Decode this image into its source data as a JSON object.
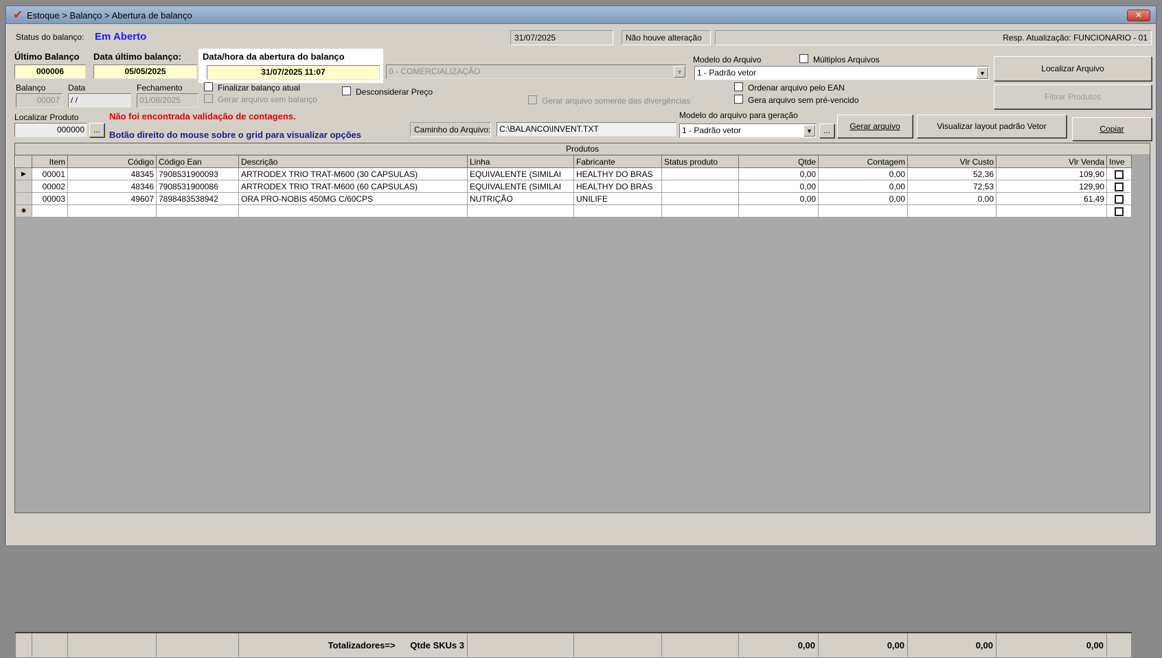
{
  "window": {
    "title": "Estoque > Balanço > Abertura de balanço",
    "logo": "✔",
    "close": "✕"
  },
  "status": {
    "label": "Status do balanço:",
    "value": "Em Aberto",
    "date": "31/07/2025",
    "alteration": "Não houve alteração",
    "resp": "Resp. Atualização: FUNCIONARIO - 01"
  },
  "header": {
    "ultimo_balanco_label": "Último Balanço",
    "ultimo_balanco_value": "000006",
    "data_ultimo_label": "Data último balanço:",
    "data_ultimo_value": "05/05/2025",
    "abertura_label": "Data/hora da abertura do balanço",
    "abertura_value": "31/07/2025 11:07",
    "comercializacao": "0 - COMERCIALIZAÇÃO",
    "modelo_arquivo_label": "Modelo do Arquivo",
    "modelo_arquivo_value": "1 - Padrão vetor",
    "multiplos_label": "Múltiplos Arquivos",
    "localizar_arquivo": "Localizar Arquivo",
    "filtrar_produtos": "Filtrar Produtos"
  },
  "form": {
    "balanco_label": "Balanço",
    "balanco_value": "00007",
    "data_label": "Data",
    "data_value": " / /",
    "fechamento_label": "Fechamento",
    "fechamento_value": "01/08/2025",
    "finalizar_label": "Finalizar balanço atual",
    "gerar_sem_balanco_label": "Gerar arquivo sem balanço",
    "desconsiderar_label": "Desconsiderar Preço",
    "gerar_divergencias_label": "Gerar arquivo somente das divergências",
    "ordenar_ean_label": "Ordenar arquivo pelo EAN",
    "gera_pre_vencido_label": "Gera arquivo sem pré-vencido",
    "localizar_produto_label": "Localizar Produto",
    "localizar_produto_value": "000000",
    "ellipsis": "...",
    "validacao_msg": "Não foi encontrada validação de contagens.",
    "botao_direito_msg": "Botão direito do mouse sobre o grid para visualizar opções",
    "caminho_label": "Caminho do Arquivo:",
    "caminho_value": "C:\\BALANCO\\INVENT.TXT",
    "modelo_geracao_label": "Modelo do arquivo para geração",
    "modelo_geracao_value": "1 - Padrão vetor",
    "gerar_arquivo": "Gerar arquivo",
    "visualizar_layout": "Visualizar layout padrão Vetor",
    "copiar": "Copiar"
  },
  "grid": {
    "caption": "Produtos",
    "columns": [
      "Item",
      "Código",
      "Código Ean",
      "Descrição",
      "Linha",
      "Fabricante",
      "Status produto",
      "Qtde",
      "Contagem",
      "Vlr Custo",
      "Vlr Venda",
      "Inve"
    ],
    "rows": [
      {
        "ind": "▶",
        "item": "00001",
        "codigo": "48345",
        "ean": "7908531900093",
        "descricao": "ARTRODEX TRIO TRAT-M600 (30 CAPSULAS)",
        "linha": "EQUIVALENTE (SIMILAI",
        "fabricante": "HEALTHY DO BRAS",
        "status": "",
        "qtde": "0,00",
        "contagem": "0,00",
        "custo": "52,36",
        "venda": "109,90"
      },
      {
        "ind": "",
        "item": "00002",
        "codigo": "48346",
        "ean": "7908531900086",
        "descricao": "ARTRODEX TRIO TRAT-M600 (60 CAPSULAS)",
        "linha": "EQUIVALENTE (SIMILAI",
        "fabricante": "HEALTHY DO BRAS",
        "status": "",
        "qtde": "0,00",
        "contagem": "0,00",
        "custo": "72,53",
        "venda": "129,90"
      },
      {
        "ind": "",
        "item": "00003",
        "codigo": "49607",
        "ean": "7898483538942",
        "descricao": "ORA PRO-NOBIS 450MG C/60CPS",
        "linha": "NUTRIÇÃO",
        "fabricante": "UNILIFE",
        "status": "",
        "qtde": "0,00",
        "contagem": "0,00",
        "custo": "0,00",
        "venda": "61,49"
      },
      {
        "ind": "✱",
        "item": "",
        "codigo": "",
        "ean": "",
        "descricao": "",
        "linha": "",
        "fabricante": "",
        "status": "",
        "qtde": "",
        "contagem": "",
        "custo": "",
        "venda": ""
      }
    ],
    "totals": {
      "label": "Totalizadores=>",
      "skus": "Qtde SKUs 3",
      "qtde": "0,00",
      "contagem": "0,00",
      "custo": "0,00",
      "venda": "0,00"
    }
  }
}
